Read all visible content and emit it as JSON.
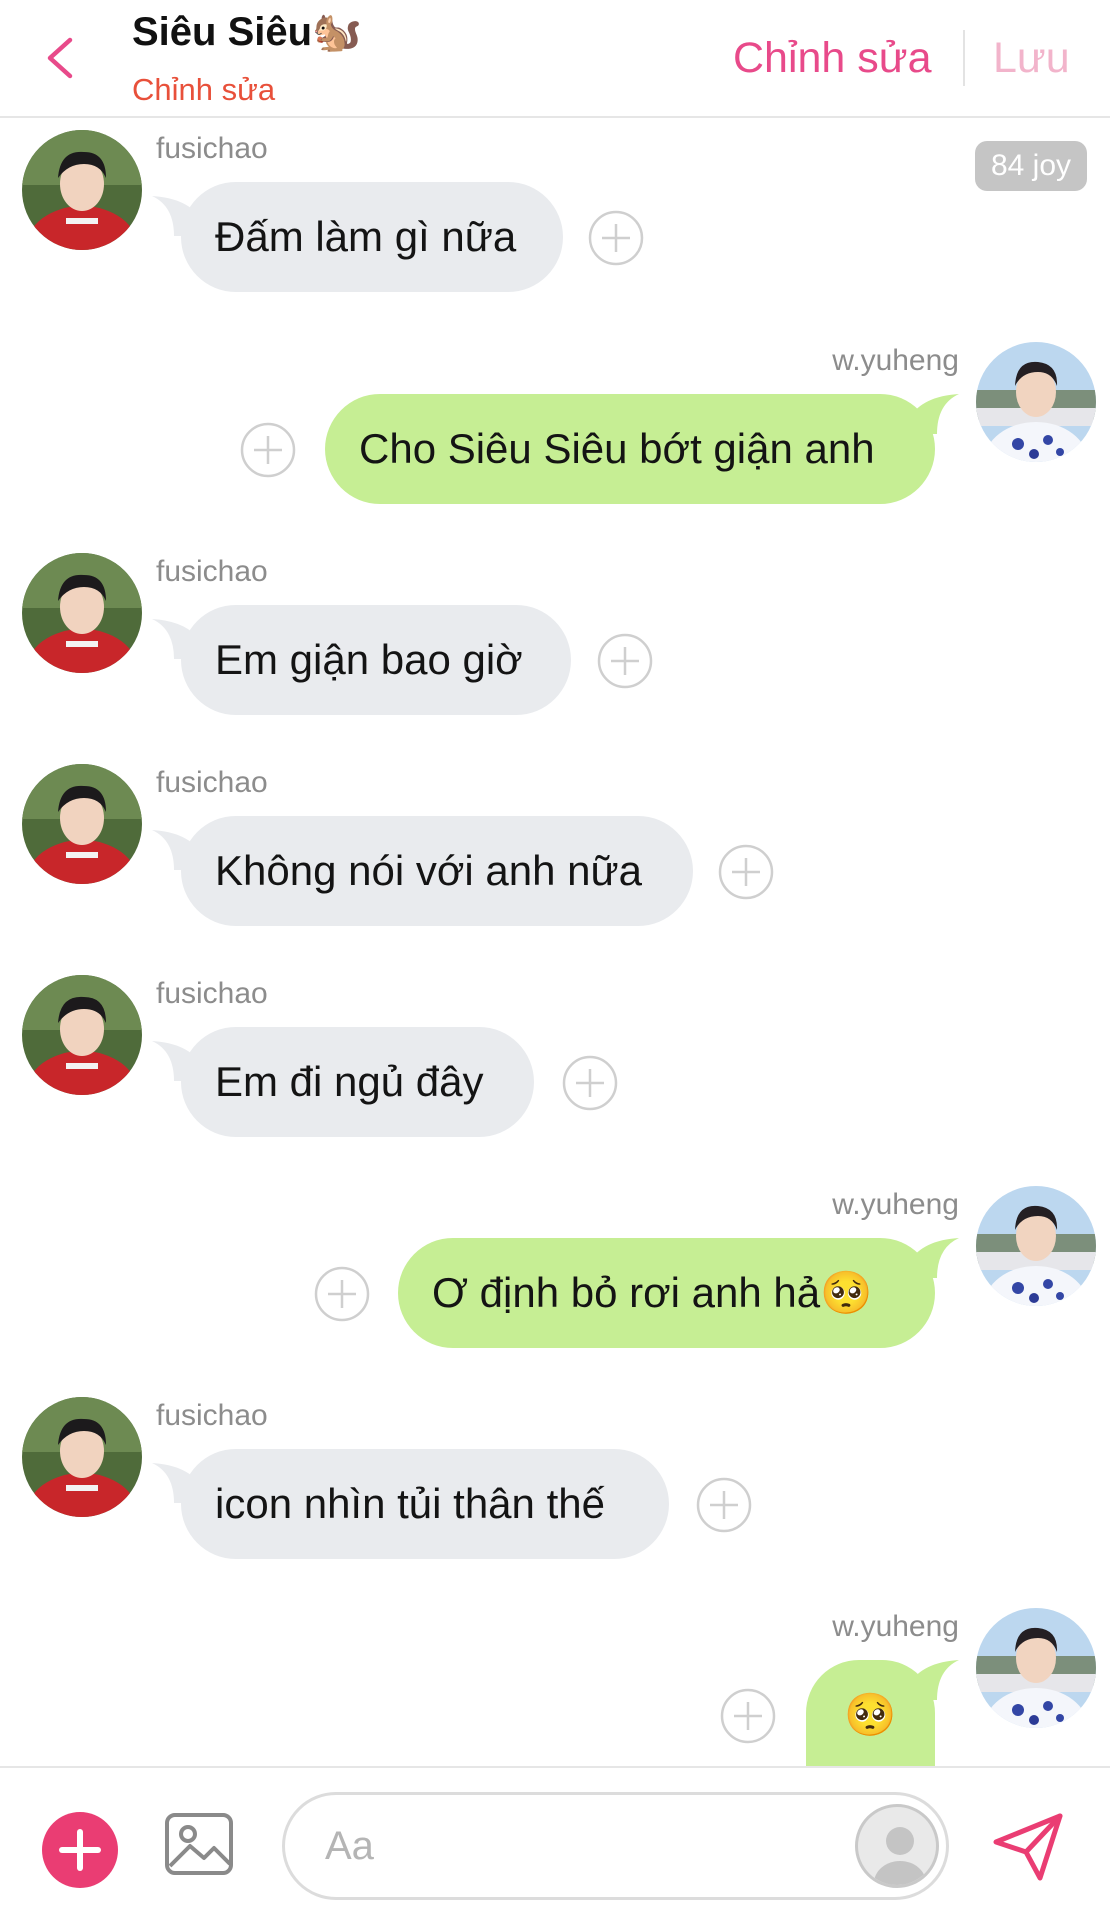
{
  "header": {
    "title": "Siêu Siêu🐿️",
    "subtitle": "Chỉnh sửa",
    "edit_label": "Chỉnh sửa",
    "save_label": "Lưu"
  },
  "badge": {
    "text": "84 joy"
  },
  "messages": [
    {
      "sender": "fusichao",
      "text": "Đấm làm gì nữa"
    },
    {
      "sender": "w.yuheng",
      "text": "Cho Siêu Siêu bớt giận anh"
    },
    {
      "sender": "fusichao",
      "text": "Em giận bao giờ"
    },
    {
      "sender": "fusichao",
      "text": "Không nói với anh nữa"
    },
    {
      "sender": "fusichao",
      "text": "Em đi ngủ đây"
    },
    {
      "sender": "w.yuheng",
      "text": "Ơ định bỏ rơi anh hả🥺"
    },
    {
      "sender": "fusichao",
      "text": "icon nhìn tủi thân thế"
    },
    {
      "sender": "w.yuheng",
      "text": "🥺"
    }
  ],
  "composer": {
    "placeholder": "Aa"
  },
  "colors": {
    "accent": "#ea3d73",
    "outgoing_bubble": "#c6ee94",
    "incoming_bubble": "#e9ebee",
    "subtitle": "#e8503a"
  },
  "icons": [
    "back-icon",
    "plus-circle-icon",
    "add-icon",
    "image-icon",
    "avatar-placeholder-icon",
    "send-icon"
  ]
}
